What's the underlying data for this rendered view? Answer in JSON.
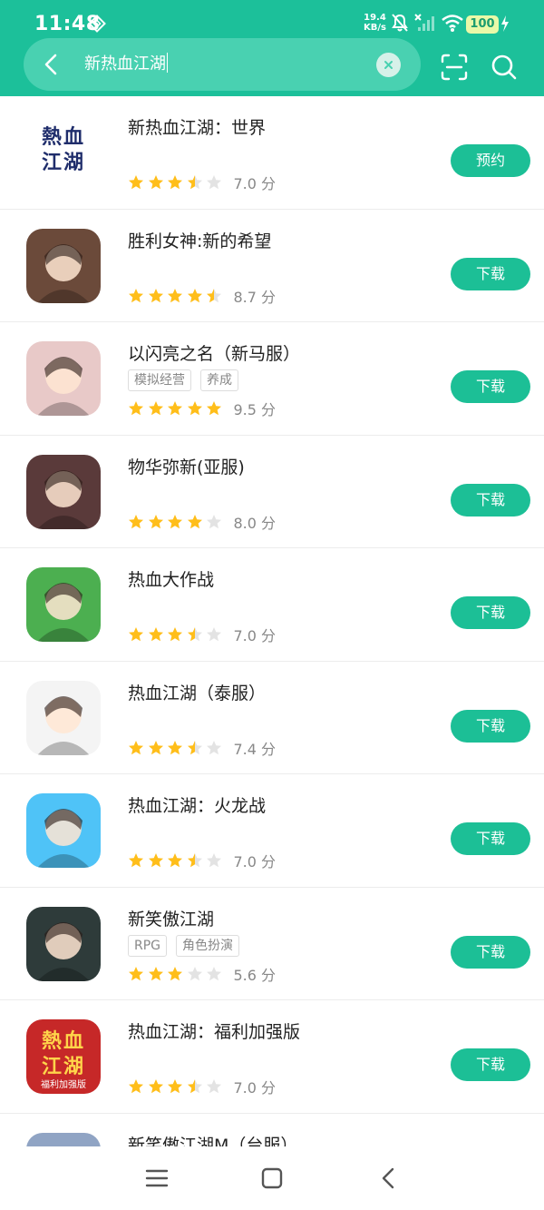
{
  "status": {
    "time": "11:48",
    "net_speed_value": "19.4",
    "net_speed_unit": "KB/s",
    "battery": "100",
    "icons": [
      "nfc-icon",
      "mute-icon",
      "signal-icon",
      "wifi-icon",
      "charging-icon"
    ]
  },
  "search": {
    "query": "新热血江湖",
    "accent_color": "#1cc09a"
  },
  "results": [
    {
      "title": "新热血江湖：世界",
      "tags": [],
      "stars": 3.5,
      "score": "7.0 分",
      "action": "预约",
      "icon": {
        "label": "熱血江湖",
        "bg": "#ffffff"
      }
    },
    {
      "title": "胜利女神:新的希望",
      "tags": [],
      "stars": 4.5,
      "score": "8.7 分",
      "action": "下载",
      "icon": {
        "bg": "#6b4a3a"
      }
    },
    {
      "title": "以闪亮之名（新马服）",
      "tags": [
        "模拟经营",
        "养成"
      ],
      "stars": 5,
      "score": "9.5 分",
      "action": "下载",
      "icon": {
        "bg": "#e8c9c8"
      }
    },
    {
      "title": "物华弥新(亚服)",
      "tags": [],
      "stars": 4,
      "score": "8.0 分",
      "action": "下载",
      "icon": {
        "bg": "#5a3a3a"
      }
    },
    {
      "title": "热血大作战",
      "tags": [],
      "stars": 3.5,
      "score": "7.0 分",
      "action": "下载",
      "icon": {
        "bg": "#4caf50"
      }
    },
    {
      "title": "热血江湖（泰服）",
      "tags": [],
      "stars": 3.5,
      "score": "7.4 分",
      "action": "下载",
      "icon": {
        "bg": "#f4f4f4"
      }
    },
    {
      "title": "热血江湖：火龙战",
      "tags": [],
      "stars": 3.5,
      "score": "7.0 分",
      "action": "下载",
      "icon": {
        "bg": "#4fc3f7"
      }
    },
    {
      "title": "新笑傲江湖",
      "tags": [
        "RPG",
        "角色扮演"
      ],
      "stars": 3,
      "score": "5.6 分",
      "action": "下载",
      "icon": {
        "bg": "#2e3b3a"
      }
    },
    {
      "title": "热血江湖：福利加强版",
      "tags": [],
      "stars": 3.5,
      "score": "7.0 分",
      "action": "下载",
      "icon": {
        "label": "熱血江湖",
        "sublabel": "福利加强版",
        "bg": "#c62828"
      }
    },
    {
      "title": "新笑傲江湖M（台服）",
      "tags": [],
      "stars": 0,
      "score": "",
      "action": "",
      "icon": {
        "bg": "#90a4c4"
      }
    }
  ],
  "colors": {
    "star_on": "#ffbe1a",
    "star_off": "#e3e3e3",
    "button": "#1cbf96"
  },
  "navbar": [
    "menu-icon",
    "home-icon",
    "back-icon"
  ]
}
